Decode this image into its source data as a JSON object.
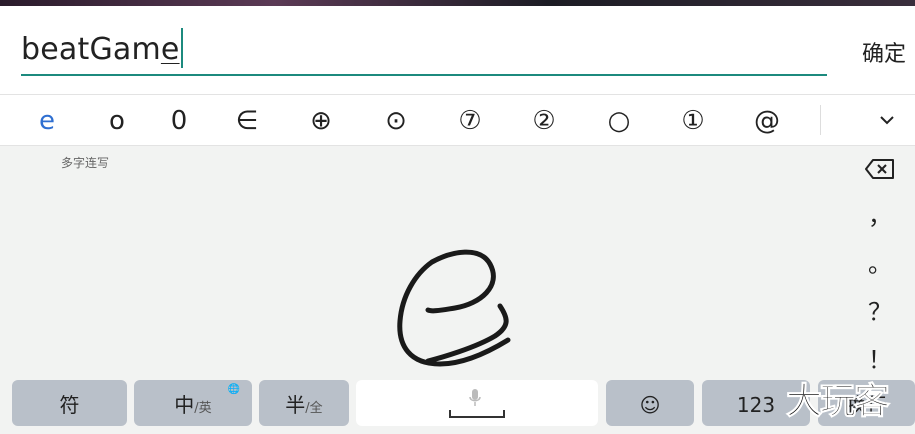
{
  "input": {
    "typed_prefix": "beatGam",
    "composing": "e",
    "confirm_label": "确定"
  },
  "candidates": {
    "items": [
      "e",
      "o",
      "0",
      "∈",
      "⊕",
      "⊙",
      "⑦",
      "②",
      "○",
      "①",
      "@"
    ],
    "active_index": 0
  },
  "handwriting": {
    "mode_label": "多字连写",
    "stroke_glyph": "e"
  },
  "side_keys": {
    "comma": "，",
    "period": "。",
    "question": "？",
    "exclaim": "！"
  },
  "bottom_row": {
    "symbols_label": "符",
    "lang_main": "中",
    "lang_sub": "/英",
    "width_main": "半",
    "width_sub": "/全",
    "emoji": "☺",
    "numbers_label": "123",
    "enter_label": "换行"
  },
  "watermark": "大玩客",
  "colors": {
    "accent": "#1c8a7e",
    "candidate_active": "#2f6fd1",
    "key_dark": "#b9c0c9",
    "key_light": "#ffffff"
  }
}
